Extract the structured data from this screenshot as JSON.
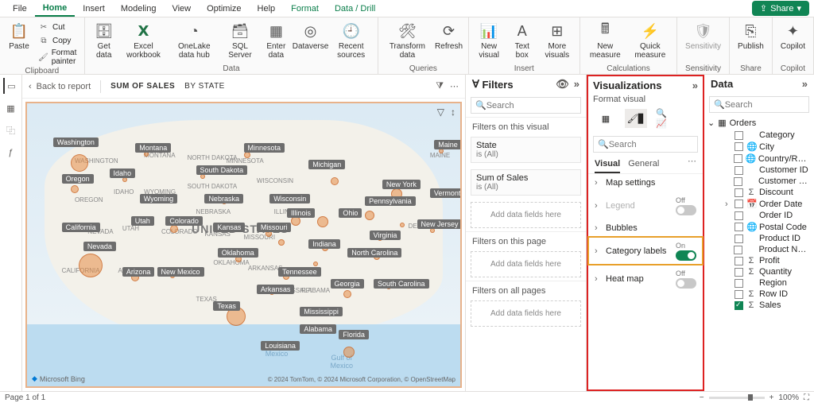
{
  "menubar": {
    "items": [
      "File",
      "Home",
      "Insert",
      "Modeling",
      "View",
      "Optimize",
      "Help",
      "Format",
      "Data / Drill"
    ],
    "active_index": 1,
    "green_indices": [
      7,
      8
    ],
    "share": "Share"
  },
  "ribbon": {
    "clipboard": {
      "paste": "Paste",
      "cut": "Cut",
      "copy": "Copy",
      "format_painter": "Format painter",
      "group": "Clipboard"
    },
    "data": {
      "get_data": "Get\ndata",
      "excel": "Excel\nworkbook",
      "onelake": "OneLake\ndata hub",
      "sql": "SQL\nServer",
      "enter": "Enter\ndata",
      "dataverse": "Dataverse",
      "recent": "Recent\nsources",
      "group": "Data"
    },
    "queries": {
      "transform": "Transform\ndata",
      "refresh": "Refresh",
      "group": "Queries"
    },
    "insert": {
      "new_visual": "New\nvisual",
      "text_box": "Text\nbox",
      "more": "More\nvisuals",
      "group": "Insert"
    },
    "calc": {
      "new_measure": "New\nmeasure",
      "quick": "Quick\nmeasure",
      "group": "Calculations"
    },
    "sensitivity": {
      "btn": "Sensitivity",
      "group": "Sensitivity"
    },
    "share": {
      "btn": "Publish",
      "group": "Share"
    },
    "copilot": {
      "btn": "Copilot",
      "group": "Copilot"
    }
  },
  "canvas": {
    "back": "Back to report",
    "crumb1": "SUM OF SALES",
    "crumb2": "BY STATE",
    "country": "UNITED STATES",
    "gulf1": "Gulf of",
    "gulf2": "Mexico",
    "gulf1b": "Gulf of",
    "gulf2b": "Mexico",
    "bing": "Microsoft Bing",
    "attrib": "© 2024 TomTom, © 2024 Microsoft Corporation, © OpenStreetMap",
    "facets": [
      {
        "t": "WASHINGTON",
        "l": 11,
        "tp": 19
      },
      {
        "t": "OREGON",
        "l": 11,
        "tp": 33
      },
      {
        "t": "IDAHO",
        "l": 20,
        "tp": 30
      },
      {
        "t": "MONTANA",
        "l": 27,
        "tp": 17
      },
      {
        "t": "WYOMING",
        "l": 27,
        "tp": 30
      },
      {
        "t": "NORTH DAKOTA",
        "l": 37,
        "tp": 18
      },
      {
        "t": "SOUTH DAKOTA",
        "l": 37,
        "tp": 28
      },
      {
        "t": "NEBRASKA",
        "l": 39,
        "tp": 37
      },
      {
        "t": "COLORADO",
        "l": 31,
        "tp": 44
      },
      {
        "t": "KANSAS",
        "l": 41,
        "tp": 45
      },
      {
        "t": "OKLAHOMA",
        "l": 43,
        "tp": 55
      },
      {
        "t": "MISSOURI",
        "l": 50,
        "tp": 46
      },
      {
        "t": "MINNESOTA",
        "l": 46,
        "tp": 19
      },
      {
        "t": "WISCONSIN",
        "l": 53,
        "tp": 26
      },
      {
        "t": "ILLINOIS",
        "l": 57,
        "tp": 37
      },
      {
        "t": "NEW MEXICO",
        "l": 30,
        "tp": 58
      },
      {
        "t": "TEXAS",
        "l": 39,
        "tp": 68
      },
      {
        "t": "ARKANSAS",
        "l": 51,
        "tp": 57
      },
      {
        "t": "MISSISSIPPI",
        "l": 57,
        "tp": 65
      },
      {
        "t": "ALABAMA",
        "l": 63,
        "tp": 65
      },
      {
        "t": "MAINE",
        "l": 93,
        "tp": 17
      },
      {
        "t": "CALIFORNIA",
        "l": 8,
        "tp": 58
      },
      {
        "t": "ARIZONA",
        "l": 21,
        "tp": 58
      },
      {
        "t": "NEVADA",
        "l": 14,
        "tp": 44
      },
      {
        "t": "UTAH",
        "l": 22,
        "tp": 43
      },
      {
        "t": "DELAWARE",
        "l": 88,
        "tp": 42
      }
    ],
    "states": [
      {
        "n": "Washington",
        "l": 6,
        "t": 12
      },
      {
        "n": "Montana",
        "l": 25,
        "t": 14
      },
      {
        "n": "Minnesota",
        "l": 50,
        "t": 14
      },
      {
        "n": "Oregon",
        "l": 8,
        "t": 25
      },
      {
        "n": "Idaho",
        "l": 19,
        "t": 23
      },
      {
        "n": "South Dakota",
        "l": 39,
        "t": 22
      },
      {
        "n": "Michigan",
        "l": 65,
        "t": 20
      },
      {
        "n": "Maine",
        "l": 94,
        "t": 13
      },
      {
        "n": "Wyoming",
        "l": 26,
        "t": 32
      },
      {
        "n": "Nebraska",
        "l": 41,
        "t": 32
      },
      {
        "n": "Wisconsin",
        "l": 56,
        "t": 32
      },
      {
        "n": "New York",
        "l": 82,
        "t": 27
      },
      {
        "n": "Vermont",
        "l": 93,
        "t": 30
      },
      {
        "n": "Utah",
        "l": 24,
        "t": 40
      },
      {
        "n": "Colorado",
        "l": 32,
        "t": 40
      },
      {
        "n": "Kansas",
        "l": 43,
        "t": 42
      },
      {
        "n": "Missouri",
        "l": 53,
        "t": 42
      },
      {
        "n": "Illinois",
        "l": 60,
        "t": 37
      },
      {
        "n": "Ohio",
        "l": 72,
        "t": 37
      },
      {
        "n": "Pennsylvania",
        "l": 78,
        "t": 33
      },
      {
        "n": "California",
        "l": 8,
        "t": 42
      },
      {
        "n": "Nevada",
        "l": 13,
        "t": 49
      },
      {
        "n": "Indiana",
        "l": 65,
        "t": 48
      },
      {
        "n": "Virginia",
        "l": 79,
        "t": 45
      },
      {
        "n": "New Jersey",
        "l": 90,
        "t": 41
      },
      {
        "n": "Arizona",
        "l": 22,
        "t": 58
      },
      {
        "n": "New Mexico",
        "l": 30,
        "t": 58
      },
      {
        "n": "Oklahoma",
        "l": 44,
        "t": 51
      },
      {
        "n": "Tennessee",
        "l": 58,
        "t": 58
      },
      {
        "n": "North Carolina",
        "l": 74,
        "t": 51
      },
      {
        "n": "Texas",
        "l": 43,
        "t": 70
      },
      {
        "n": "Arkansas",
        "l": 53,
        "t": 64
      },
      {
        "n": "Georgia",
        "l": 70,
        "t": 62
      },
      {
        "n": "South Carolina",
        "l": 80,
        "t": 62
      },
      {
        "n": "Mississippi",
        "l": 63,
        "t": 72
      },
      {
        "n": "Alabama",
        "l": 63,
        "t": 78
      },
      {
        "n": "Florida",
        "l": 72,
        "t": 80
      },
      {
        "n": "Louisiana",
        "l": 54,
        "t": 84
      }
    ],
    "bubbles": [
      {
        "l": 10,
        "t": 18,
        "s": 22
      },
      {
        "l": 12,
        "t": 53,
        "s": 30
      },
      {
        "l": 10,
        "t": 29,
        "s": 10
      },
      {
        "l": 46,
        "t": 72,
        "s": 24
      },
      {
        "l": 73,
        "t": 86,
        "s": 14
      },
      {
        "l": 84,
        "t": 30,
        "s": 14
      },
      {
        "l": 78,
        "t": 38,
        "s": 12
      },
      {
        "l": 70,
        "t": 26,
        "s": 10
      },
      {
        "l": 61,
        "t": 40,
        "s": 12
      },
      {
        "l": 58,
        "t": 48,
        "s": 8
      },
      {
        "l": 67,
        "t": 40,
        "s": 14
      },
      {
        "l": 55,
        "t": 45,
        "s": 8
      },
      {
        "l": 80,
        "t": 53,
        "s": 8
      },
      {
        "l": 73,
        "t": 66,
        "s": 10
      },
      {
        "l": 59,
        "t": 60,
        "s": 8
      },
      {
        "l": 33,
        "t": 43,
        "s": 10
      },
      {
        "l": 24,
        "t": 60,
        "s": 10
      },
      {
        "l": 88,
        "t": 33,
        "s": 8
      },
      {
        "l": 95,
        "t": 16,
        "s": 6
      },
      {
        "l": 50,
        "t": 17,
        "s": 8
      },
      {
        "l": 40,
        "t": 25,
        "s": 6
      },
      {
        "l": 45,
        "t": 34,
        "s": 6
      },
      {
        "l": 28,
        "t": 33,
        "s": 6
      },
      {
        "l": 22,
        "t": 26,
        "s": 6
      },
      {
        "l": 27,
        "t": 17,
        "s": 6
      },
      {
        "l": 48,
        "t": 54,
        "s": 8
      },
      {
        "l": 33,
        "t": 60,
        "s": 6
      },
      {
        "l": 56,
        "t": 66,
        "s": 6
      },
      {
        "l": 65,
        "t": 78,
        "s": 6
      },
      {
        "l": 86,
        "t": 42,
        "s": 6
      },
      {
        "l": 93,
        "t": 44,
        "s": 6
      },
      {
        "l": 81,
        "t": 47,
        "s": 6
      },
      {
        "l": 68,
        "t": 50,
        "s": 8
      },
      {
        "l": 83,
        "t": 64,
        "s": 6
      },
      {
        "l": 66,
        "t": 56,
        "s": 6
      }
    ]
  },
  "filters": {
    "title": "Filters",
    "search_ph": "Search",
    "sect_visual": "Filters on this visual",
    "card1": {
      "name": "State",
      "val": "is (All)"
    },
    "card2": {
      "name": "Sum of Sales",
      "val": "is (All)"
    },
    "drop": "Add data fields here",
    "sect_page": "Filters on this page",
    "sect_all": "Filters on all pages"
  },
  "viz": {
    "title": "Visualizations",
    "sub": "Format visual",
    "search_ph": "Search",
    "tab_visual": "Visual",
    "tab_general": "General",
    "rows": [
      {
        "name": "Map settings",
        "toggle": null
      },
      {
        "name": "Legend",
        "toggle": "off",
        "dim": true
      },
      {
        "name": "Bubbles",
        "toggle": null
      },
      {
        "name": "Category labels",
        "toggle": "on",
        "hl": true
      },
      {
        "name": "Heat map",
        "toggle": "off"
      }
    ]
  },
  "data": {
    "title": "Data",
    "search_ph": "Search",
    "table": "Orders",
    "fields": [
      {
        "n": "Category",
        "i": ""
      },
      {
        "n": "City",
        "i": "🌐"
      },
      {
        "n": "Country/Region",
        "i": "🌐"
      },
      {
        "n": "Customer ID",
        "i": ""
      },
      {
        "n": "Customer Na…",
        "i": ""
      },
      {
        "n": "Discount",
        "i": "Σ"
      },
      {
        "n": "Order Date",
        "i": "📅",
        "exp": true
      },
      {
        "n": "Order ID",
        "i": ""
      },
      {
        "n": "Postal Code",
        "i": "🌐"
      },
      {
        "n": "Product ID",
        "i": ""
      },
      {
        "n": "Product Name",
        "i": ""
      },
      {
        "n": "Profit",
        "i": "Σ"
      },
      {
        "n": "Quantity",
        "i": "Σ"
      },
      {
        "n": "Region",
        "i": ""
      },
      {
        "n": "Row ID",
        "i": "Σ"
      },
      {
        "n": "Sales",
        "i": "Σ",
        "chk": true
      }
    ]
  },
  "status": {
    "page": "Page 1 of 1",
    "zoom": "100%"
  }
}
